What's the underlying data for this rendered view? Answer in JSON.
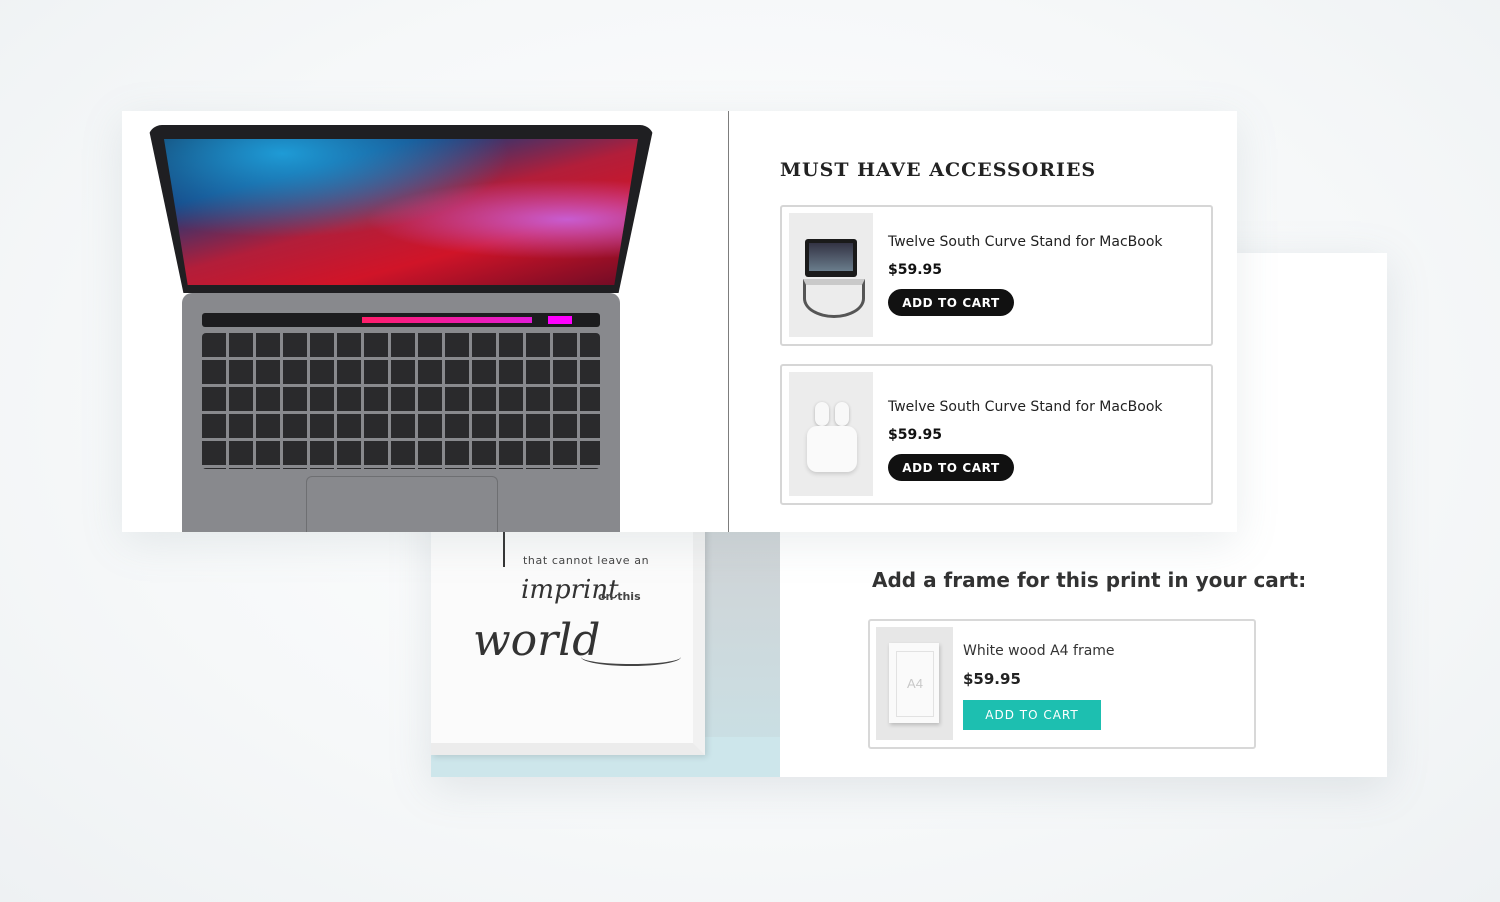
{
  "accessories": {
    "title": "MUST HAVE ACCESSORIES",
    "items": [
      {
        "name": "Twelve South Curve Stand for MacBook",
        "price": "$59.95",
        "button": "ADD TO CART"
      },
      {
        "name": "Twelve South Curve Stand for MacBook",
        "price": "$59.95",
        "button": "ADD TO CART"
      }
    ]
  },
  "print": {
    "line1": "that cannot leave an",
    "word_imprint": "imprint",
    "word_onthis": "on this",
    "word_world": "world"
  },
  "frame_upsell": {
    "title": "Add a frame for this print in your cart:",
    "product": {
      "name": "White wood A4 frame",
      "price": "$59.95",
      "button": "ADD TO CART",
      "thumb_label": "A4"
    }
  },
  "colors": {
    "teal": "#1dbfb0",
    "black_button": "#111111"
  },
  "icons": [
    "macbook-illustration",
    "laptop-stand-thumbnail",
    "airpods-thumbnail",
    "frame-thumbnail"
  ]
}
